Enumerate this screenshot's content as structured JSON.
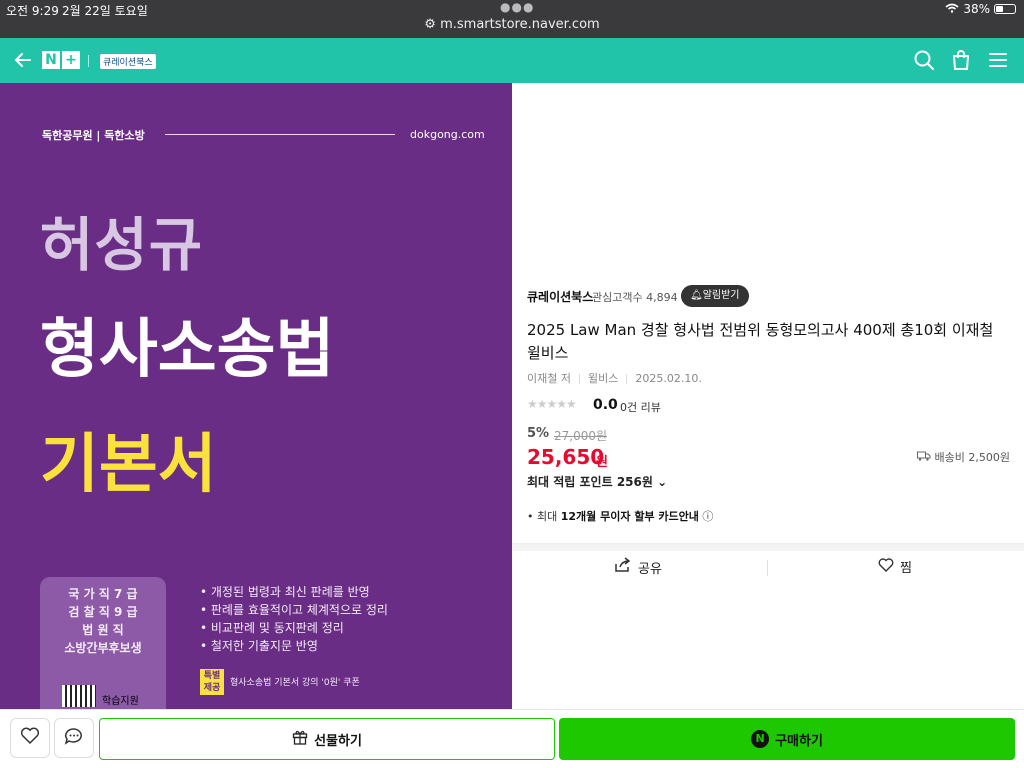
{
  "status_bar": {
    "time": "오전 9:29",
    "date": "2월 22일 토요일",
    "url": "m.smartstore.naver.com",
    "battery": "38%",
    "battery_level": 0.38
  },
  "nav": {
    "brand_left": "N",
    "brand_right": "+",
    "store_logo": "큐레이션북스",
    "icons": [
      "back-arrow-icon",
      "search-icon",
      "shopping-bag-icon",
      "menu-icon"
    ]
  },
  "cover": {
    "publisher": "독한공무원 | 독한소방",
    "site": "dokgong.com",
    "title_line1": "허성규",
    "title_line2": "형사소송법",
    "title_line3": "기본서",
    "exams": [
      "국 가 직  7 급",
      "검 찰 직  9 급",
      "법  원  직",
      "소방간부후보생"
    ],
    "study_label": "학습지원",
    "features": [
      "• 개정된 법령과 최신 판례를 반영",
      "• 판례를 효율적이고 체계적으로 정리",
      "• 비교판례 및 동지판례 정리",
      "• 철저한 기출지문 반영"
    ],
    "special_badge": "특별\n제공",
    "coupon": "형사소송법 기본서 강의 '0원' 쿠폰"
  },
  "product": {
    "seller": "큐레이션북스",
    "followers": "관심고객수 4,894",
    "alarm_button": "알림받기",
    "title": "2025 Law Man 경찰 형사법 전범위 동형모의고사 400제 총10회 이재철 윌비스",
    "author": "이재철 저",
    "publisher": "윌비스",
    "date": "2025.02.10.",
    "stars": "★★★★★",
    "rating": "0.0",
    "review_count": "0건 리뷰",
    "discount": "5%",
    "original_price": "27,000원",
    "sale_price": "25,650",
    "currency": "원",
    "shipping": "배송비 2,500원",
    "points": "최대 적립 포인트 256원",
    "installment_prefix": "최대",
    "installment_bold": "12개월 무이자 할부 카드안내",
    "share": "공유",
    "zzim": "찜"
  },
  "bottom": {
    "gift": "선물하기",
    "buy": "구매하기",
    "buy_logo": "N"
  },
  "colors": {
    "naver_teal": "#21c4a8",
    "buy_green": "#1ec800",
    "price_red": "#e30b2e",
    "cover_purple": "#6a2d86",
    "cover_yellow": "#fbe13b"
  }
}
